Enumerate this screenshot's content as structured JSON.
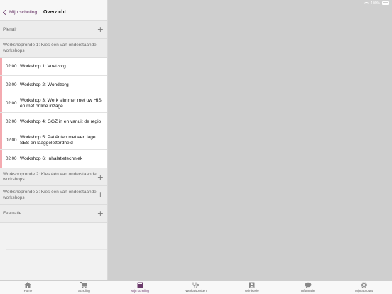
{
  "status_bar": {
    "battery": "100%"
  },
  "nav": {
    "back_label": "Mijn scholing",
    "title": "Overzicht"
  },
  "sections": {
    "plenair": "Plenair",
    "ronde1": "Workshopronde 1: Kies één van onderstaande workshops",
    "ronde2": "Workshopronde 2: Kies één van onderstaande workshops",
    "ronde3": "Workshopronde 3: Kies één van onderstaande workshops",
    "evaluatie": "Evaluatie"
  },
  "toggles": {
    "plus": "+",
    "minus": "−"
  },
  "workshops": [
    {
      "time": "02:00",
      "title": "Workshop 1: Voetzorg"
    },
    {
      "time": "02:00",
      "title": "Workshop 2: Wondzorg"
    },
    {
      "time": "02:00",
      "title": "Workshop 3: Werk slimmer met uw HIS en met online inzage"
    },
    {
      "time": "02:00",
      "title": "Workshop 4: GGZ in en vanuit de regio"
    },
    {
      "time": "02:00",
      "title": "Workshop 5: Patiënten met een lage SES en laaggeletterdheid"
    },
    {
      "time": "02:00",
      "title": "Workshop 6: Inhalatietechniek"
    }
  ],
  "tabs": [
    {
      "label": "Home",
      "icon": "home-icon"
    },
    {
      "label": "Scholing",
      "icon": "cart-icon"
    },
    {
      "label": "Mijn scholing",
      "icon": "book-icon"
    },
    {
      "label": "Werkafspraken",
      "icon": "stethoscope-icon"
    },
    {
      "label": "Wie is wie",
      "icon": "person-card-icon"
    },
    {
      "label": "Informatie",
      "icon": "chat-icon"
    },
    {
      "label": "Mijn account",
      "icon": "gear-icon"
    }
  ],
  "colors": {
    "accent": "#6b3a6b",
    "workshop_marker": "#f4aab0",
    "detail_bg": "#cfcfcf"
  }
}
